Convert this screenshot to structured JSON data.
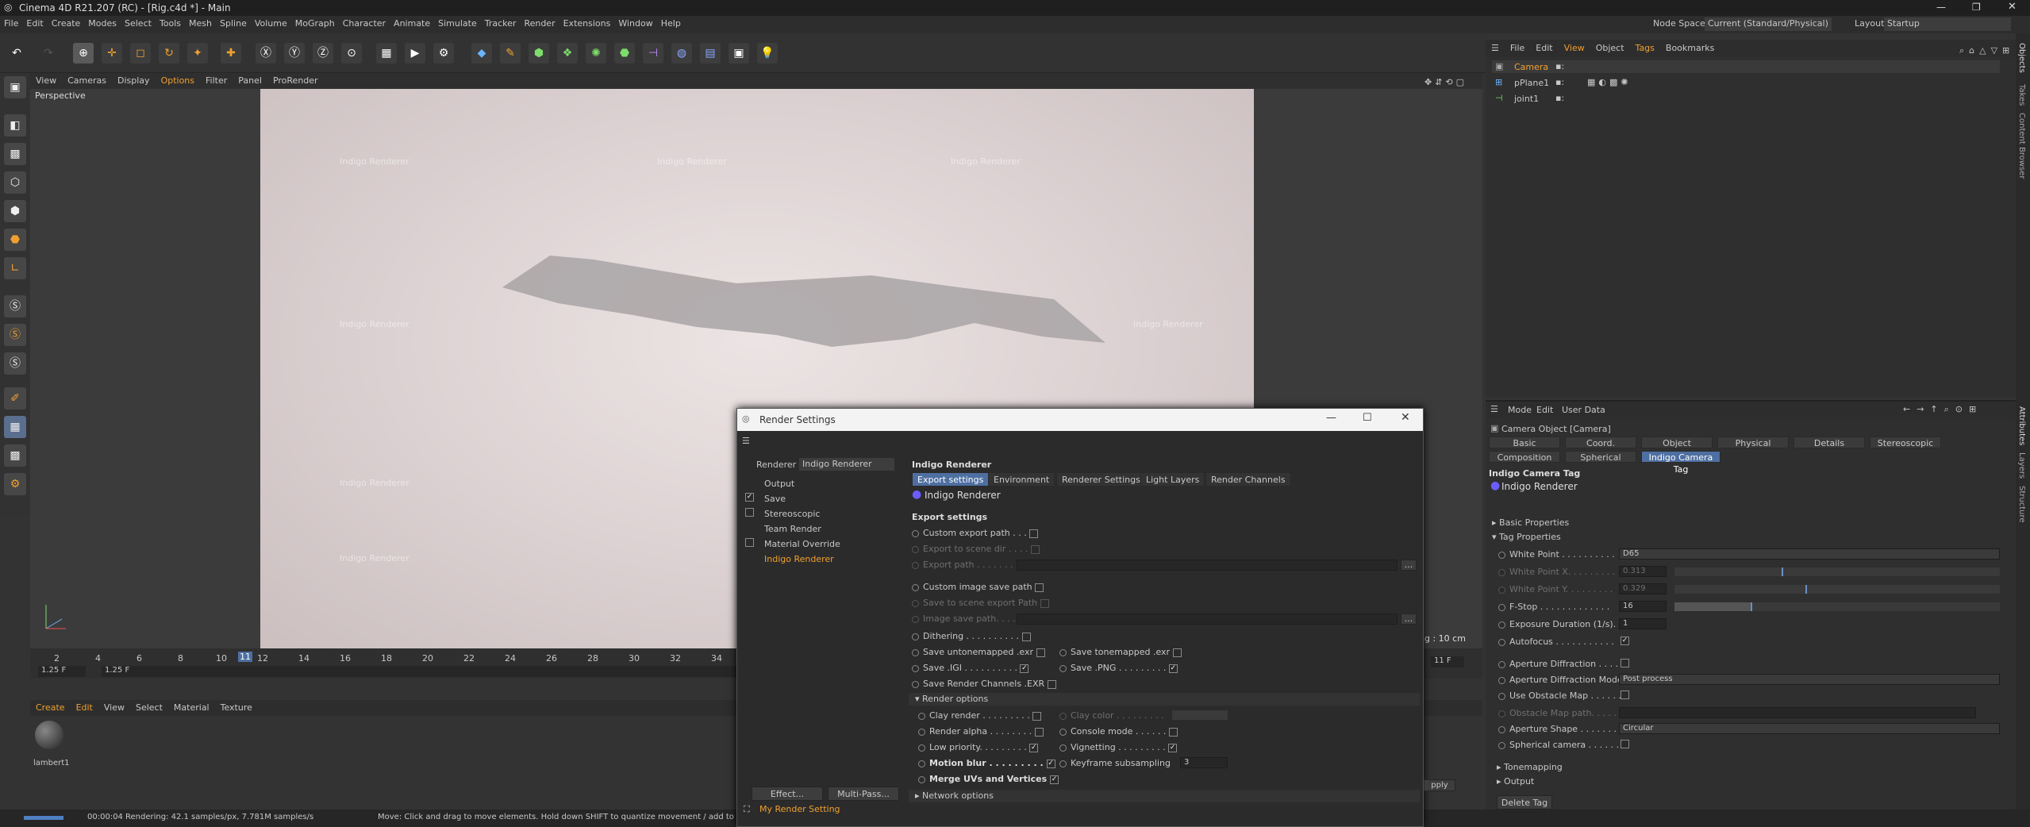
{
  "app": {
    "title": "Cinema 4D R21.207 (RC) - [Rig.c4d *] - Main"
  },
  "menu": [
    "File",
    "Edit",
    "Create",
    "Modes",
    "Select",
    "Tools",
    "Mesh",
    "Spline",
    "Volume",
    "MoGraph",
    "Character",
    "Animate",
    "Simulate",
    "Tracker",
    "Render",
    "Extensions",
    "Window",
    "Help"
  ],
  "nodespace": {
    "label": "Node Space:",
    "value": "Current (Standard/Physical)"
  },
  "layout": {
    "label": "Layout:",
    "value": "Startup"
  },
  "viewport": {
    "menu": [
      "View",
      "Cameras",
      "Display",
      "Options",
      "Filter",
      "Panel",
      "ProRender"
    ],
    "label": "Perspective",
    "watermark": "Indigo Renderer",
    "scale": "ng : 10 cm"
  },
  "timeline": {
    "ticks": [
      "2",
      "4",
      "6",
      "8",
      "10",
      "12",
      "14",
      "16",
      "18",
      "20",
      "22",
      "24",
      "26",
      "28",
      "30",
      "32",
      "34"
    ],
    "current_frame": "11",
    "start": "1.25 F",
    "start2": "1.25 F",
    "end": "11 F"
  },
  "material": {
    "menu": [
      "Create",
      "Edit",
      "View",
      "Select",
      "Material",
      "Texture"
    ],
    "name": "lambert1"
  },
  "status": {
    "time": "00:00:04",
    "rendering": "Rendering: 42.1 samples/px, 7.781M samples/s",
    "hint": "Move: Click and drag to move elements. Hold down SHIFT to quantize movement / add to the"
  },
  "objects": {
    "menu": [
      "File",
      "Edit",
      "View",
      "Object",
      "Tags",
      "Bookmarks"
    ],
    "items": [
      "Camera",
      "pPlane1",
      "joint1"
    ]
  },
  "sidetabs": [
    "Objects",
    "Takes",
    "Content Browser",
    "Attributes",
    "Layers",
    "Structure"
  ],
  "attributes": {
    "menu": [
      "Mode",
      "Edit",
      "User Data"
    ],
    "object_label": "Camera Object [Camera]",
    "tabs_row1": [
      "Basic",
      "Coord.",
      "Object",
      "Physical",
      "Details",
      "Stereoscopic"
    ],
    "tabs_row2": [
      "Composition",
      "Spherical",
      "Indigo Camera Tag"
    ],
    "section": "Indigo Camera Tag",
    "brand": "Indigo Renderer",
    "groups": [
      "Basic Properties",
      "Tag Properties"
    ],
    "props": [
      {
        "label": "White Point . . . . . . . . . .",
        "value": "D65"
      },
      {
        "label": "White Point X. . . . . . . . .",
        "value": "0.313"
      },
      {
        "label": "White Point Y. . . . . . . . .",
        "value": "0.329"
      },
      {
        "label": "F-Stop . . . . . . . . . . . . .",
        "value": "16"
      },
      {
        "label": "Exposure Duration (1/s). .",
        "value": "1"
      },
      {
        "label": "Autofocus . . . . . . . . . . .",
        "value": ""
      },
      {
        "label": "Aperture Diffraction . . . .",
        "value": ""
      },
      {
        "label": "Aperture Diffraction Mode",
        "value": "Post process"
      },
      {
        "label": "Use Obstacle Map . . . . . .",
        "value": ""
      },
      {
        "label": "Obstacle Map path. . . . . .",
        "value": ""
      },
      {
        "label": "Aperture Shape . . . . . . . .",
        "value": "Circular"
      },
      {
        "label": "Spherical camera . . . . . . .",
        "value": ""
      }
    ],
    "groups2": [
      "Tonemapping",
      "Output"
    ],
    "delete_tag": "Delete Tag"
  },
  "dialog": {
    "title": "Render Settings",
    "renderer_label": "Renderer",
    "renderer_value": "Indigo Renderer",
    "tree": [
      "Output",
      "Save",
      "Stereoscopic",
      "Team Render",
      "Material Override",
      "Indigo Renderer"
    ],
    "effect_btn": "Effect...",
    "multipass_btn": "Multi-Pass...",
    "my_setting": "My Render Setting",
    "heading": "Indigo Renderer",
    "tabs": [
      "Export settings",
      "Environment",
      "Renderer Settings",
      "Light Layers",
      "Render Channels"
    ],
    "brand": "Indigo Renderer",
    "export_heading": "Export settings",
    "opts": {
      "custom_export": "Custom export path . . .",
      "export_scene": "Export to scene dir . . . .",
      "export_path": "Export path . . . . . . . . .",
      "custom_image": "Custom image save path",
      "save_scene": "Save to scene export Path",
      "image_path": "Image save path. . . . . . .",
      "dithering": "Dithering . . . . . . . . . .",
      "save_untone": "Save untonemapped .exr",
      "save_tone": "Save tonemapped .exr",
      "save_igi": "Save .IGI . . . . . . . . . .",
      "save_png": "Save .PNG . . . . . . . . .",
      "save_channels": "Save Render Channels .EXR",
      "render_options": "Render options",
      "clay_render": "Clay render . . . . . . . . .",
      "clay_color": "Clay color . . . . . . . . .",
      "render_alpha": "Render alpha . . . . . . . .",
      "console_mode": "Console mode . . . . . .",
      "low_priority": "Low priority. . . . . . . . .",
      "vignetting": "Vignetting . . . . . . . . .",
      "motion_blur": "Motion blur . . . . . . . . .",
      "keyframe_sub": "Keyframe subsampling",
      "keyframe_val": "3",
      "merge_uvs": "Merge UVs and Vertices",
      "network": "Network options",
      "apply": "pply"
    }
  }
}
